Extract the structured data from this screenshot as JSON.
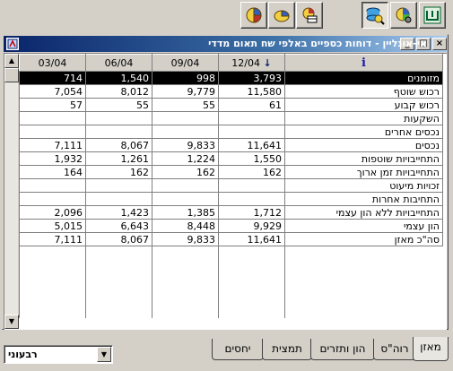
{
  "toolbar": {
    "buttons": [
      {
        "name": "pie-chart-icon",
        "pressed": false
      },
      {
        "name": "pie-chart-yellow-icon",
        "pressed": false
      },
      {
        "name": "pie-chart-table-icon",
        "pressed": false
      },
      {
        "name": "data-lookup-icon",
        "pressed": true
      },
      {
        "name": "pie-chart-gear-icon",
        "pressed": false
      },
      {
        "name": "app-logo-icon",
        "pressed": false
      }
    ]
  },
  "window": {
    "title": "אי-אונליין - דוחות כספיים באלפי שח תאום מדדי",
    "min_label": "_",
    "max_label": "□",
    "close_label": "×"
  },
  "grid": {
    "columns": [
      "03/04",
      "06/04",
      "09/04",
      "12/04"
    ],
    "sorted_column_arrow": "↓",
    "info_label": "i",
    "rows": [
      {
        "label": "מזומנים",
        "values": [
          "714",
          "1,540",
          "998",
          "3,793"
        ],
        "selected": true
      },
      {
        "label": "רכוש שוטף",
        "values": [
          "7,054",
          "8,012",
          "9,779",
          "11,580"
        ]
      },
      {
        "label": "רכוש קבוע",
        "values": [
          "57",
          "55",
          "55",
          "61"
        ]
      },
      {
        "label": "השקעות",
        "values": [
          "",
          "",
          "",
          ""
        ]
      },
      {
        "label": "נכסים אחרים",
        "values": [
          "",
          "",
          "",
          ""
        ]
      },
      {
        "label": "נכסים",
        "values": [
          "7,111",
          "8,067",
          "9,833",
          "11,641"
        ]
      },
      {
        "label": "התחייבויות שוטפות",
        "values": [
          "1,932",
          "1,261",
          "1,224",
          "1,550"
        ]
      },
      {
        "label": "התחייבויות זמן ארוך",
        "values": [
          "164",
          "162",
          "162",
          "162"
        ]
      },
      {
        "label": "זכויות מיעוט",
        "values": [
          "",
          "",
          "",
          ""
        ]
      },
      {
        "label": "התחיבות אחרות",
        "values": [
          "",
          "",
          "",
          ""
        ]
      },
      {
        "label": "התחייבויות ללא הון עצמי",
        "values": [
          "2,096",
          "1,423",
          "1,385",
          "1,712"
        ]
      },
      {
        "label": "הון עצמי",
        "values": [
          "5,015",
          "6,643",
          "8,448",
          "9,929"
        ]
      },
      {
        "label": "סה\"כ מאזן",
        "values": [
          "7,111",
          "8,067",
          "9,833",
          "11,641"
        ]
      }
    ]
  },
  "period_combo": {
    "value": "רבעוני"
  },
  "tabs": [
    {
      "label": "מאזן",
      "active": true
    },
    {
      "label": "רוה\"ס",
      "active": false
    },
    {
      "label": "הון ותזרים",
      "active": false
    },
    {
      "label": "תמצית",
      "active": false
    },
    {
      "label": "יחסים",
      "active": false
    }
  ]
}
